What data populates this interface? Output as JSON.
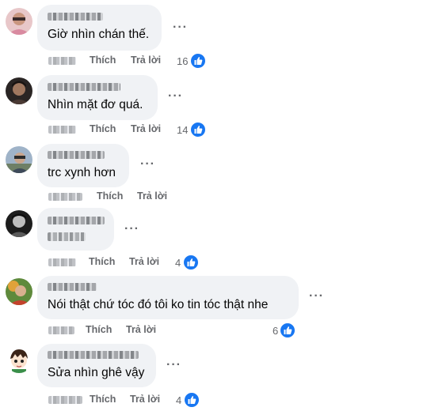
{
  "labels": {
    "like": "Thích",
    "reply": "Trả lời",
    "more": "···"
  },
  "colors": {
    "like_blue": "#1877f2",
    "bubble": "#f0f2f5",
    "meta_gray": "#65676b"
  },
  "comments": [
    {
      "text": "Giờ nhìn chán thế.",
      "reactions": "16",
      "avatar_icon": "person-photo-pink"
    },
    {
      "text": "Nhìn mặt đơ quá.",
      "reactions": "14",
      "avatar_icon": "person-photo-dark"
    },
    {
      "text": "trc xynh hơn",
      "reactions": "",
      "avatar_icon": "person-photo-outdoor"
    },
    {
      "text": "",
      "reactions": "4",
      "avatar_icon": "person-photo-bw"
    },
    {
      "text": "Nói thật chứ tóc đó tôi ko tin tóc thật nhe",
      "reactions": "6",
      "avatar_icon": "person-photo-nature"
    },
    {
      "text": "Sửa nhìn ghê vậy",
      "reactions": "4",
      "avatar_icon": "cartoon-avatar"
    }
  ]
}
